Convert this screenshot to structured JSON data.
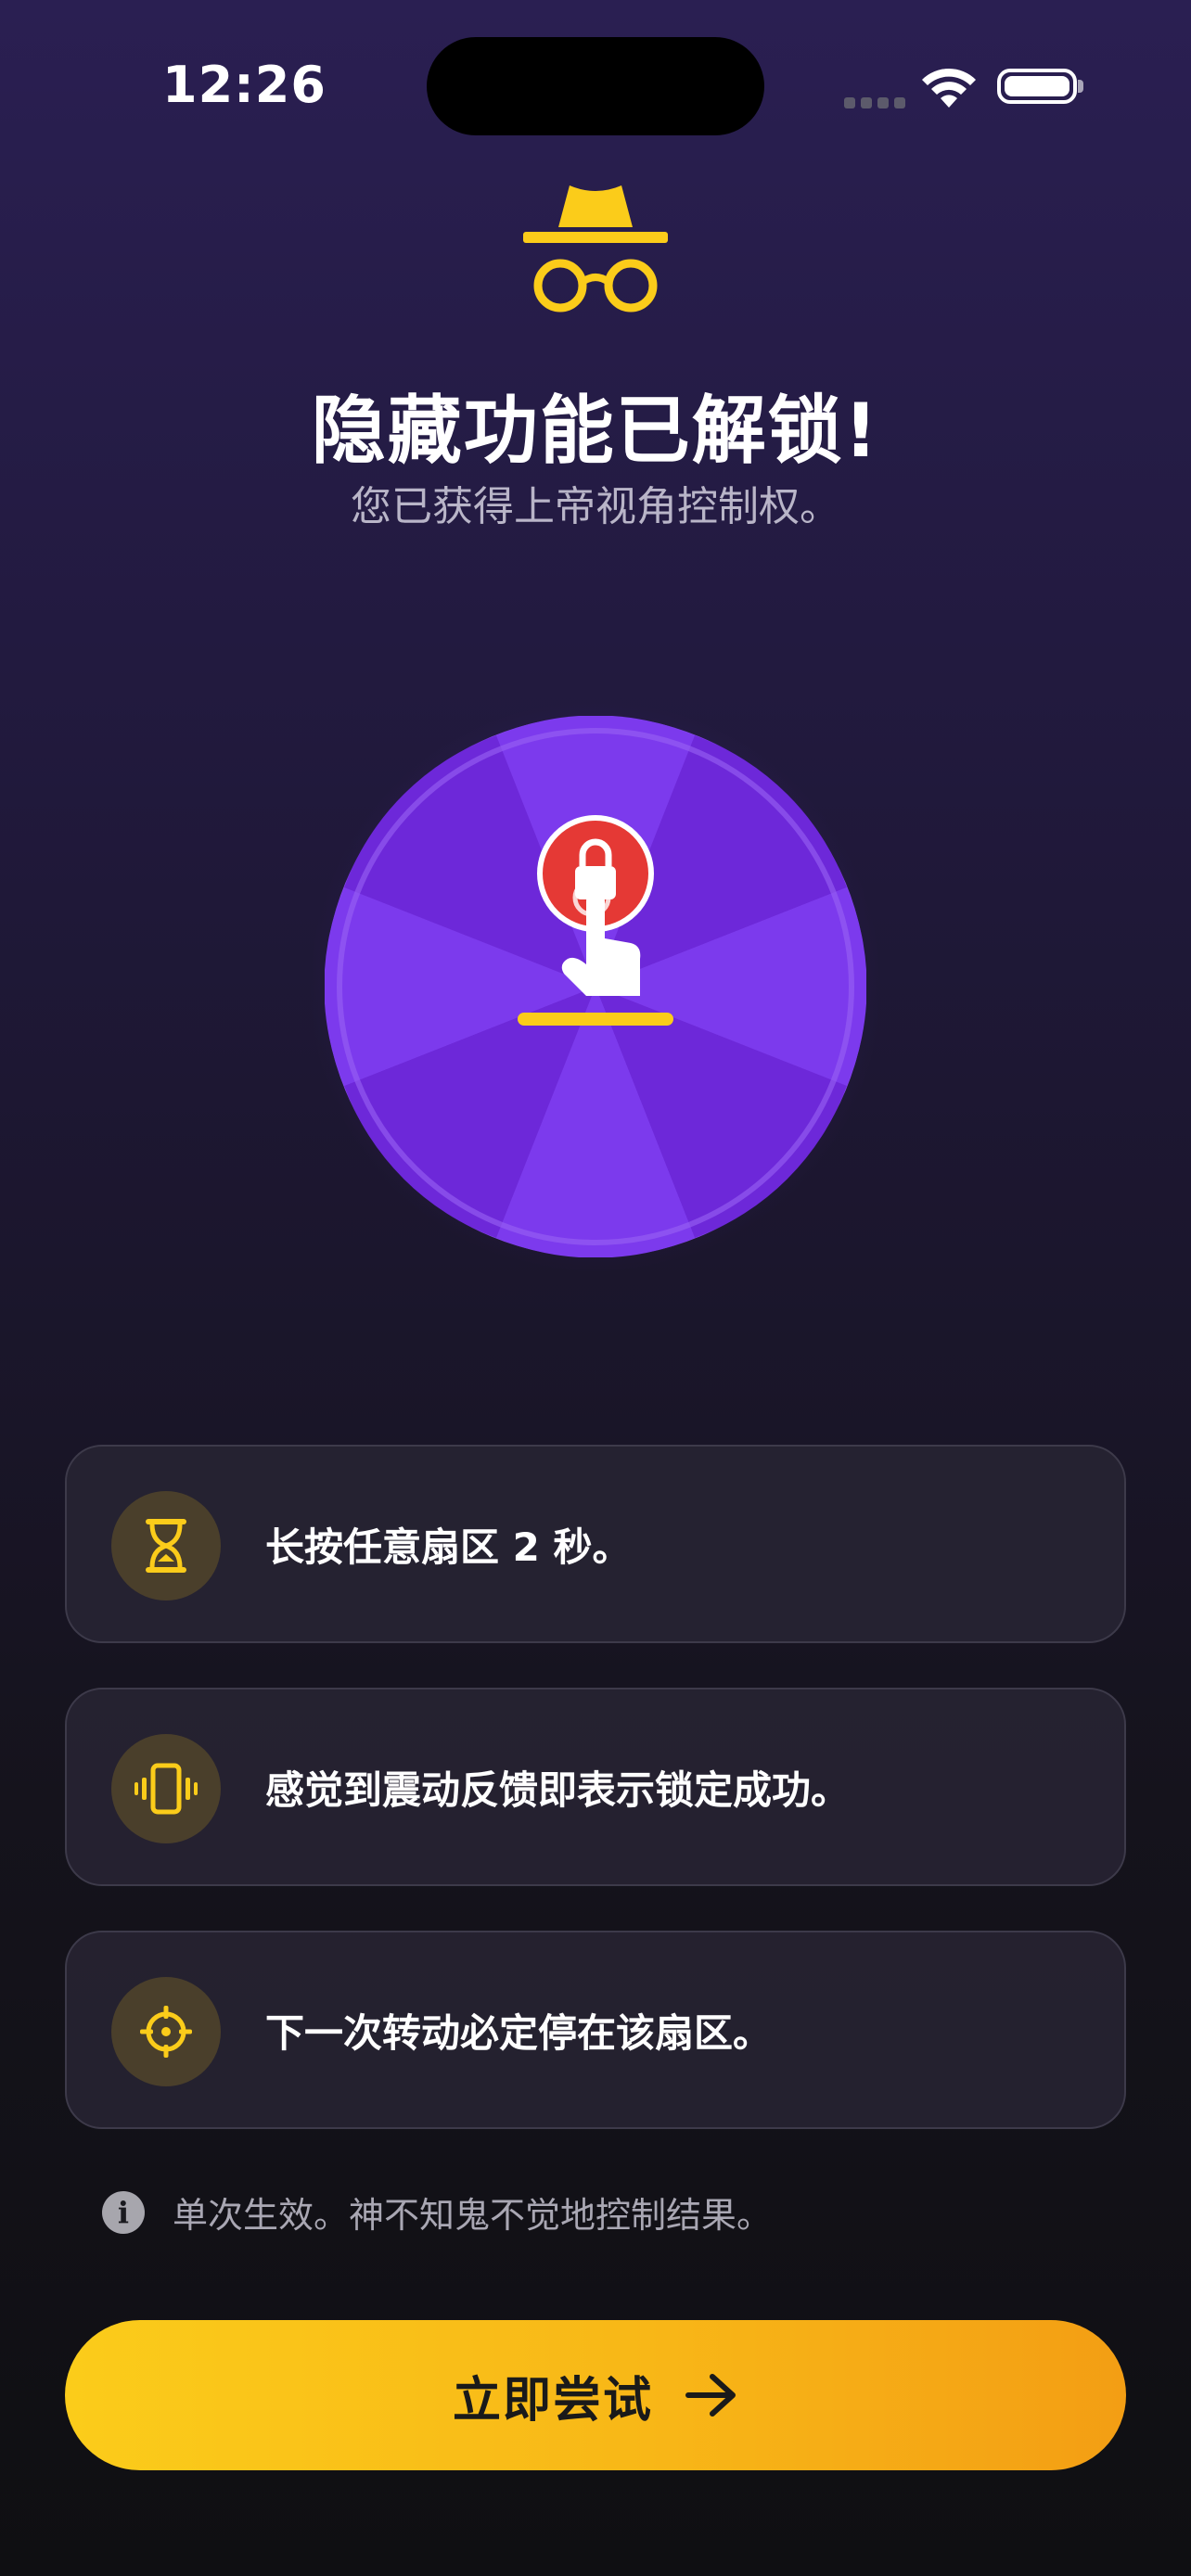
{
  "status_bar": {
    "time": "12:26"
  },
  "header": {
    "title": "隐藏功能已解锁!",
    "subtitle": "您已获得上帝视角控制权。"
  },
  "colors": {
    "accent": "#FBCC1A",
    "wheel": "#7C3AED",
    "lock": "#E53935"
  },
  "steps": [
    {
      "icon": "hourglass-icon",
      "text": "长按任意扇区 2 秒。"
    },
    {
      "icon": "vibration-icon",
      "text": "感觉到震动反馈即表示锁定成功。"
    },
    {
      "icon": "crosshair-icon",
      "text": "下一次转动必定停在该扇区。"
    }
  ],
  "note": {
    "icon": "info-icon",
    "text": "单次生效。神不知鬼不觉地控制结果。"
  },
  "cta": {
    "label": "立即尝试"
  }
}
